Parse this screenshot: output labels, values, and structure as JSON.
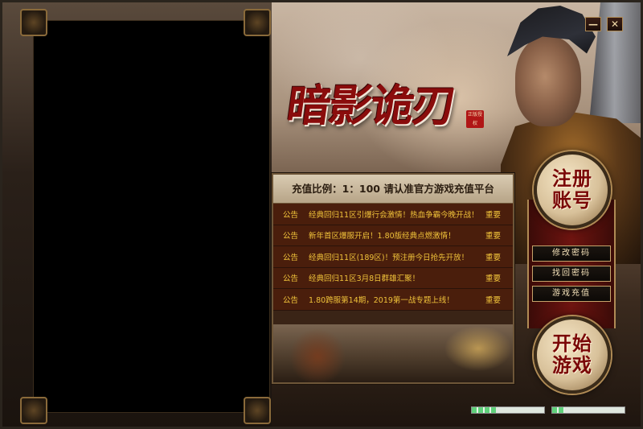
{
  "window": {
    "minimize_label": "—",
    "close_label": "✕"
  },
  "logo": {
    "title": "暗影诡刃",
    "seal": "正版授权"
  },
  "notice_panel": {
    "header": "充值比例：1：100 请认准官方游戏充值平台",
    "notices": [
      {
        "tag": "公告",
        "text": "经典回归11区引爆行会激情！热血争霸今晚开战！",
        "level": "重要"
      },
      {
        "tag": "公告",
        "text": "新年首区爆服开启！1.80版经典点燃激情！",
        "level": "重要"
      },
      {
        "tag": "公告",
        "text": "经典回归11区(189区)！预注册今日抢先开放！",
        "level": "重要"
      },
      {
        "tag": "公告",
        "text": "经典回归11区3月8日群雄汇聚！",
        "level": "重要"
      },
      {
        "tag": "公告",
        "text": "1.80跨服第14期，2019第一战专题上线！",
        "level": "重要"
      }
    ]
  },
  "actions": {
    "register": "注册账号",
    "change_password": "修改密码",
    "recover_password": "找回密码",
    "recharge": "游戏充值",
    "start_game": "开始游戏"
  },
  "progress": {
    "bar1_fraction": 0.33,
    "bar2_fraction": 0.17
  },
  "colors": {
    "accent": "#8a0c0c",
    "notice_text": "#f0c23a",
    "progress_fill": "#5fd07a"
  }
}
